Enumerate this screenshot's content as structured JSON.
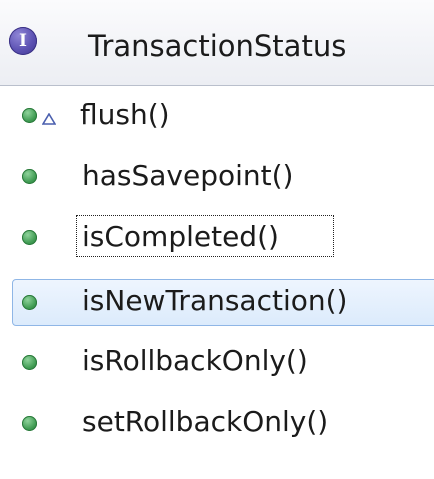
{
  "header": {
    "interface_icon_letter": "I",
    "title": "TransactionStatus"
  },
  "methods": [
    {
      "label": "flush()",
      "icon": "public-method-icon",
      "overlay": "default-access-triangle-icon"
    },
    {
      "label": "hasSavepoint()",
      "icon": "public-method-icon"
    },
    {
      "label": "isCompleted()",
      "icon": "public-method-icon",
      "focused": true
    },
    {
      "label": "isNewTransaction()",
      "icon": "public-method-icon",
      "selected": true
    },
    {
      "label": "isRollbackOnly()",
      "icon": "public-method-icon"
    },
    {
      "label": "setRollbackOnly()",
      "icon": "public-method-icon"
    }
  ],
  "colors": {
    "method_icon_green": "#3f9b52",
    "interface_icon_purple": "#5d52b3",
    "selection_border": "#8fb6e6",
    "selection_fill": "#dcebfc"
  }
}
